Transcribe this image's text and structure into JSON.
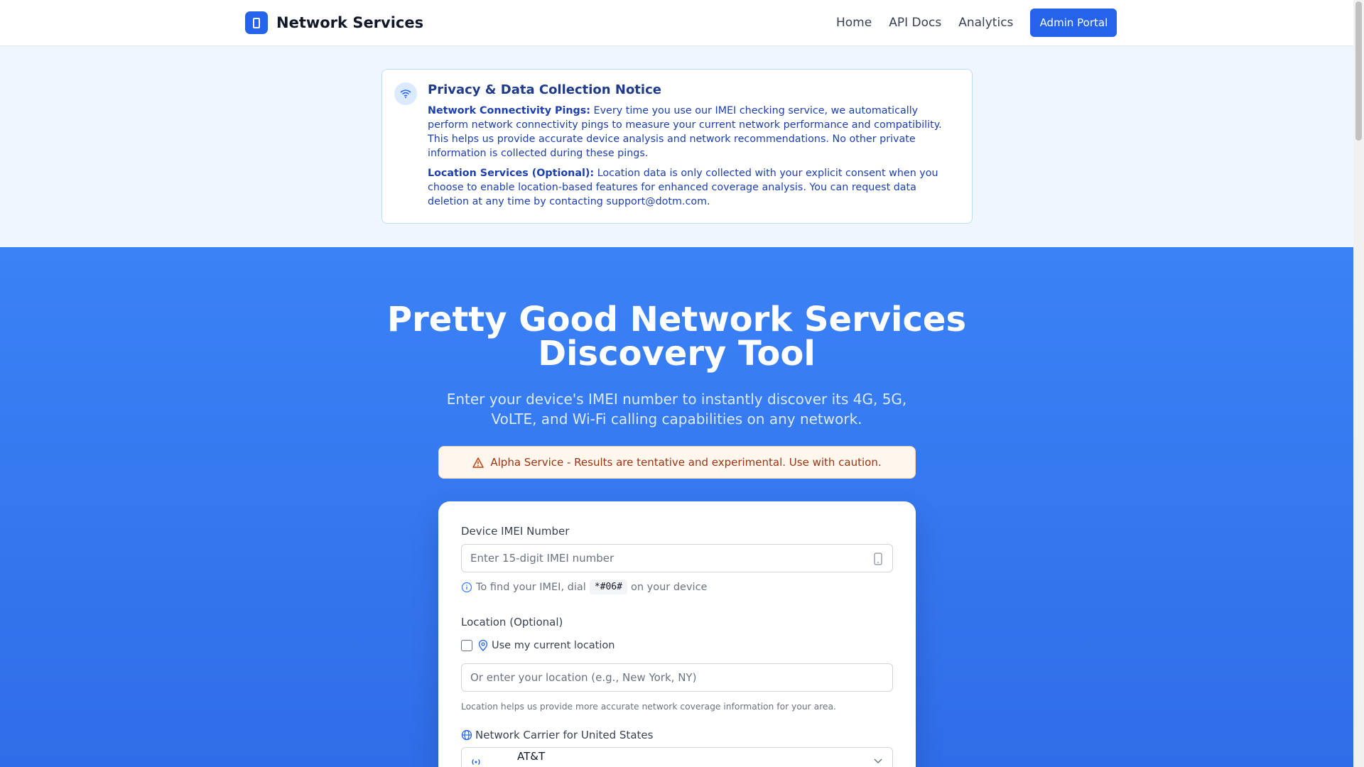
{
  "header": {
    "brand": "Network Services",
    "nav": [
      "Home",
      "API Docs",
      "Analytics"
    ],
    "admin_button": "Admin Portal"
  },
  "notice": {
    "title": "Privacy & Data Collection Notice",
    "pings_label": "Network Connectivity Pings:",
    "pings_text": " Every time you use our IMEI checking service, we automatically perform network connectivity pings to measure your current network performance and compatibility. This helps us provide accurate device analysis and network recommendations. No other private information is collected during these pings.",
    "location_label": "Location Services (Optional):",
    "location_text": " Location data is only collected with your explicit consent when you choose to enable location-based features for enhanced coverage analysis. You can request data deletion at any time by contacting support@dotm.com."
  },
  "hero": {
    "title_line1": "Pretty Good Network Services",
    "title_line2": "Discovery Tool",
    "subtitle": "Enter your device's IMEI number to instantly discover its 4G, 5G, VoLTE, and Wi-Fi calling capabilities on any network.",
    "alert": "Alpha Service - Results are tentative and experimental. Use with caution."
  },
  "form": {
    "imei_label": "Device IMEI Number",
    "imei_placeholder": "Enter 15-digit IMEI number",
    "imei_hint_pre": "To find your IMEI, dial",
    "imei_hint_code": "*#06#",
    "imei_hint_post": "on your device",
    "location_label": "Location (Optional)",
    "use_location_label": "Use my current location",
    "location_placeholder": "Or enter your location (e.g., New York, NY)",
    "location_help": "Location helps us provide more accurate network coverage information for your area.",
    "carrier_label": "Network Carrier for United States",
    "carrier_selected": "AT&T"
  },
  "colors": {
    "primary": "#2563eb",
    "hero_bg": "#3b82f6",
    "alert_bg": "#fff7ed",
    "alert_text": "#9a3412"
  }
}
